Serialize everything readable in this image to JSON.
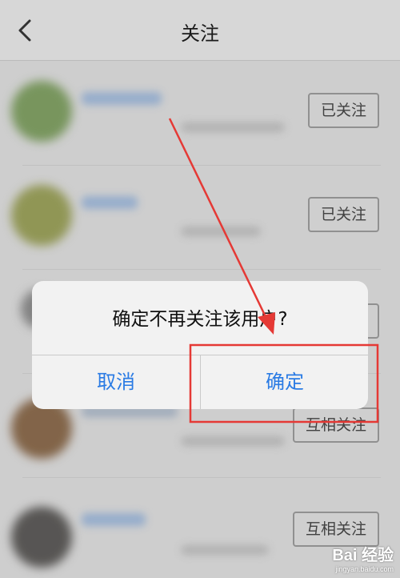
{
  "nav": {
    "title": "关注",
    "back_icon": "chevron-left-icon"
  },
  "list": {
    "rows": [
      {
        "button": "已关注"
      },
      {
        "button": "已关注"
      },
      {
        "button": ""
      },
      {
        "button": "互相关注"
      },
      {
        "button": "互相关注"
      }
    ]
  },
  "dialog": {
    "message": "确定不再关注该用户?",
    "cancel": "取消",
    "confirm": "确定"
  },
  "watermark": {
    "main": "Bai 经验",
    "url": "jingyan.baidu.com"
  },
  "colors": {
    "accent": "#2a7be4",
    "annotation": "#e53935"
  }
}
